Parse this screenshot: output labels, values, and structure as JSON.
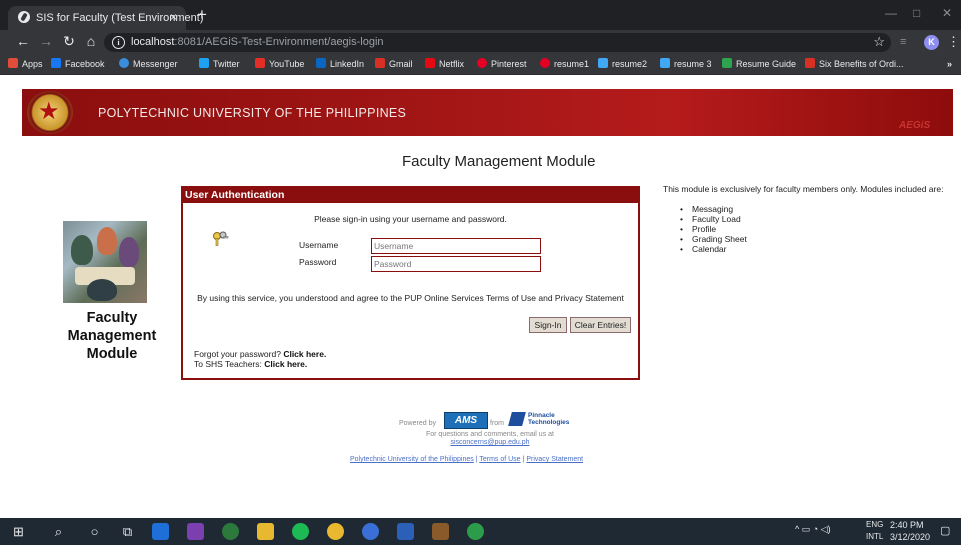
{
  "browser": {
    "tab_title": "SIS for Faculty (Test Environment)",
    "tab_close": "×",
    "new_tab": "+",
    "url_host": "localhost",
    "url_rest": ":8081/AEGiS-Test-Environment/aegis-login",
    "avatar_letter": "K"
  },
  "bookmarks": [
    {
      "label": "Apps",
      "color": "#e34b3a"
    },
    {
      "label": "Facebook",
      "color": "#1877f2"
    },
    {
      "label": "Messenger",
      "color": "#3a8dde"
    },
    {
      "label": "Twitter",
      "color": "#1da1f2"
    },
    {
      "label": "YouTube",
      "color": "#e52d27"
    },
    {
      "label": "LinkedIn",
      "color": "#0a66c2"
    },
    {
      "label": "Gmail",
      "color": "#d93025"
    },
    {
      "label": "Netflix",
      "color": "#e50914"
    },
    {
      "label": "Pinterest",
      "color": "#e60023"
    },
    {
      "label": "resume1",
      "color": "#e60023"
    },
    {
      "label": "resume2",
      "color": "#3fa9f5"
    },
    {
      "label": "resume 3",
      "color": "#3fa9f5"
    },
    {
      "label": "Resume Guide",
      "color": "#2ea44f"
    },
    {
      "label": "Six Benefits of Ordi...",
      "color": "#d93025"
    }
  ],
  "banner": {
    "title": "POLYTECHNIC UNIVERSITY OF THE PHILIPPINES",
    "right_mark": "AEGiS"
  },
  "page": {
    "module_title": "Faculty Management Module",
    "left_label_1": "Faculty",
    "left_label_2": "Management",
    "left_label_3": "Module"
  },
  "auth": {
    "header": "User Authentication",
    "instruction": "Please sign-in using your username and password.",
    "username_label": "Username",
    "password_label": "Password",
    "username_placeholder": "Username",
    "password_placeholder": "Password",
    "terms": "By using this service, you understood and agree to the PUP Online Services Terms of Use and Privacy Statement",
    "signin_label": "Sign-In",
    "clear_label": "Clear Entries!",
    "forgot_text": "Forgot your password?",
    "forgot_link": "Click here.",
    "shs_text": "To SHS Teachers:",
    "shs_link": "Click here."
  },
  "side": {
    "note": "This module is exclusively for faculty members only. Modules included are:",
    "modules": [
      "Messaging",
      "Faculty Load",
      "Profile",
      "Grading Sheet",
      "Calendar"
    ]
  },
  "footer": {
    "powered_by": "Powered by",
    "ams_logo": "AMS",
    "from": "from",
    "pinnacle": "Pinnacle Technologies",
    "questions": "For questions and comments, email us at",
    "email": "sisconcerns@pup.edu.ph",
    "link_pup": "Polytechnic University of the Philippines",
    "sep": "|",
    "link_terms": "Terms of Use",
    "link_privacy": "Privacy Statement"
  },
  "taskbar": {
    "lang_1": "ENG",
    "lang_2": "INTL",
    "time": "2:40 PM",
    "date": "3/12/2020"
  }
}
